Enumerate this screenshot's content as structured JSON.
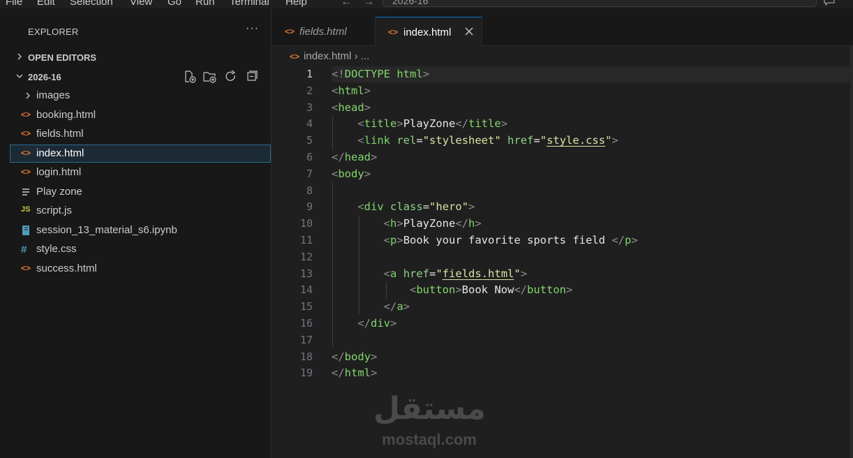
{
  "menu": {
    "items": [
      "File",
      "Edit",
      "Selection",
      "View",
      "Go",
      "Run",
      "Terminal",
      "Help"
    ],
    "search_text": "2026-16"
  },
  "explorer": {
    "title": "EXPLORER",
    "more": "···",
    "open_editors": "OPEN EDITORS",
    "folder": "2026-16",
    "files": [
      {
        "name": "images",
        "type": "folder-icon"
      },
      {
        "name": "booking.html",
        "type": "html-icon"
      },
      {
        "name": "fields.html",
        "type": "html-icon"
      },
      {
        "name": "index.html",
        "type": "html-icon"
      },
      {
        "name": "login.html",
        "type": "html-icon"
      },
      {
        "name": "Play zone",
        "type": "text-file-icon"
      },
      {
        "name": "script.js",
        "type": "js-icon"
      },
      {
        "name": "session_13_material_s6.ipynb",
        "type": "notebook-icon"
      },
      {
        "name": "style.css",
        "type": "css-icon"
      },
      {
        "name": "success.html",
        "type": "html-icon"
      }
    ]
  },
  "tabs": [
    {
      "label": "fields.html",
      "active": false
    },
    {
      "label": "index.html",
      "active": true
    }
  ],
  "breadcrumb": {
    "file": "index.html",
    "rest": "..."
  },
  "editor": {
    "current_line": 1,
    "line_numbers": [
      "1",
      "2",
      "3",
      "4",
      "5",
      "6",
      "7",
      "8",
      "9",
      "10",
      "11",
      "12",
      "13",
      "14",
      "15",
      "16",
      "17",
      "18",
      "19"
    ]
  },
  "watermark": {
    "arabic": "مستقل",
    "latin": "mostaql.com"
  },
  "colors": {
    "accent": "#0078d4",
    "html_icon": "#e37933",
    "js_icon": "#cbcb41",
    "css_icon": "#519aba"
  }
}
